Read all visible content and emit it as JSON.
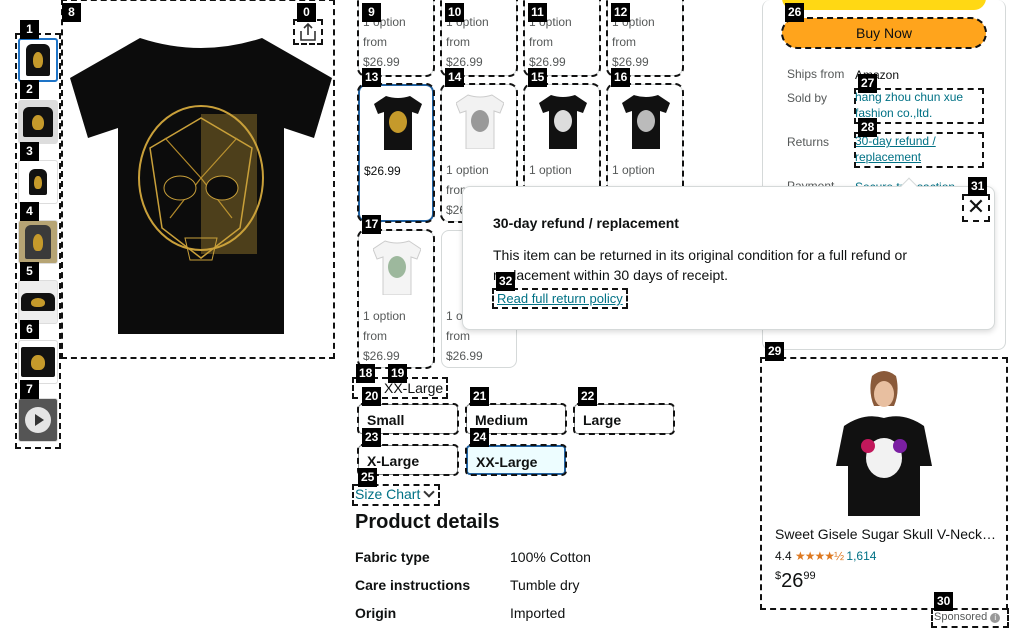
{
  "labels": {
    "n0": "0",
    "n1": "1",
    "n2": "2",
    "n3": "3",
    "n4": "4",
    "n5": "5",
    "n6": "6",
    "n7": "7",
    "n8": "8",
    "n9": "9",
    "n10": "10",
    "n11": "11",
    "n12": "12",
    "n13": "13",
    "n14": "14",
    "n15": "15",
    "n16": "16",
    "n17": "17",
    "n18": "18",
    "n19": "19",
    "n20": "20",
    "n21": "21",
    "n22": "22",
    "n23": "23",
    "n24": "24",
    "n25": "25",
    "n26": "26",
    "n27": "27",
    "n28": "28",
    "n29": "29",
    "n30": "30",
    "n31": "31",
    "n32": "32"
  },
  "variants": {
    "v9": {
      "option": "1 option",
      "from": "from",
      "price": "$26.99"
    },
    "v10": {
      "option": "1 option",
      "from": "from",
      "price": "$26.99"
    },
    "v11": {
      "option": "1 option",
      "from": "from",
      "price": "$26.99"
    },
    "v12": {
      "option": "1 option",
      "from": "from",
      "price": "$26.99"
    },
    "v13": {
      "price": "$26.99"
    },
    "v14": {
      "option": "1 option",
      "from": "from",
      "price": "$26"
    },
    "v15": {
      "option": "1 option"
    },
    "v16": {
      "option": "1 option"
    },
    "v17": {
      "option": "1 option",
      "from": "from",
      "price": "$26.99"
    },
    "v18": {
      "option": "1 o",
      "from": "from",
      "price": "$26.99"
    }
  },
  "size": {
    "selected_label": "XX-Large",
    "options": [
      "Small",
      "Medium",
      "Large",
      "X-Large",
      "XX-Large"
    ],
    "chart_link": "Size Chart"
  },
  "details": {
    "heading": "Product details",
    "rows": [
      {
        "key": "Fabric type",
        "value": "100% Cotton"
      },
      {
        "key": "Care instructions",
        "value": "Tumble dry"
      },
      {
        "key": "Origin",
        "value": "Imported"
      }
    ]
  },
  "buybox": {
    "buy_now": "Buy Now",
    "ships_from_label": "Ships from",
    "ships_from_value": "Amazon",
    "sold_by_label": "Sold by",
    "sold_by_value": "hang zhou chun xue fashion co.,ltd.",
    "returns_label": "Returns",
    "returns_value": "30-day refund / replacement",
    "payment_label": "Payment",
    "payment_value": "Secure transaction"
  },
  "popover": {
    "title": "30-day refund / replacement",
    "body": "This item can be returned in its original condition for a full refund or replacement within 30 days of receipt.",
    "link": "Read full return policy",
    "close": "✕"
  },
  "ad": {
    "title": "Sweet Gisele Sugar Skull V-Neck…",
    "rating": "4.4",
    "stars": "★★★★½",
    "count": "1,614",
    "currency": "$",
    "price_whole": "26",
    "price_frac": "99",
    "sponsored": "Sponsored",
    "info_icon": "i"
  },
  "colors": {
    "accent": "#2162a1",
    "buy_now": "#ffa41c",
    "link": "#007185",
    "star": "#de7921"
  }
}
